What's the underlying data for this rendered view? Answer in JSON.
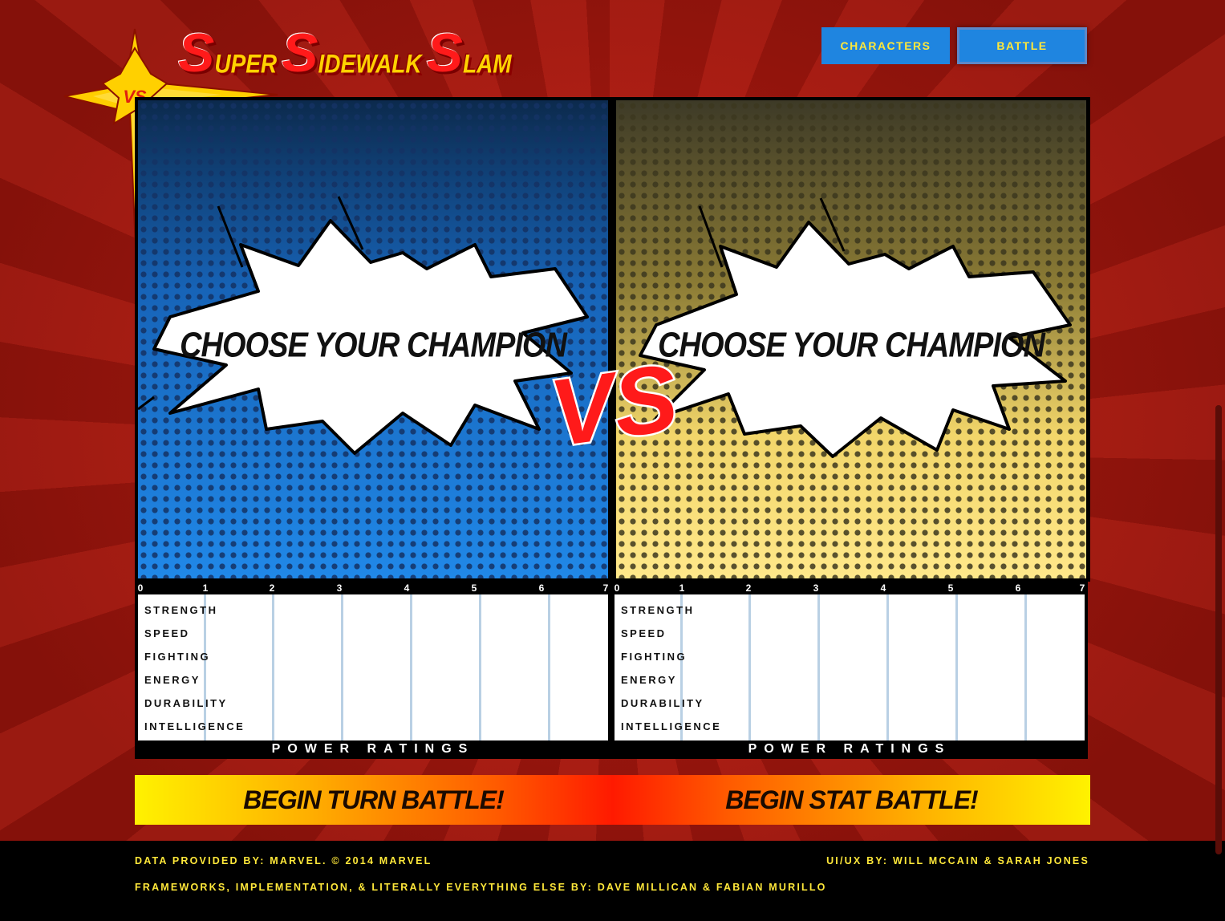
{
  "logo": {
    "words": [
      {
        "cap": "S",
        "rest": "UPER"
      },
      {
        "cap": "S",
        "rest": "IDEWALK"
      },
      {
        "cap": "S",
        "rest": "LAM"
      }
    ],
    "badge": "VS"
  },
  "nav": {
    "characters": "CHARACTERS",
    "battle": "BATTLE"
  },
  "panels": {
    "left": {
      "prompt": "CHOOSE YOUR CHAMPION"
    },
    "right": {
      "prompt": "CHOOSE YOUR CHAMPION"
    },
    "vs": "VS"
  },
  "ratings": {
    "scale": [
      "0",
      "1",
      "2",
      "3",
      "4",
      "5",
      "6",
      "7"
    ],
    "stats": [
      "STRENGTH",
      "SPEED",
      "FIGHTING",
      "ENERGY",
      "DURABILITY",
      "INTELLIGENCE"
    ],
    "title": "POWER RATINGS"
  },
  "actions": {
    "turn_battle": "BEGIN TURN BATTLE!",
    "stat_battle": "BEGIN STAT BATTLE!"
  },
  "footer": {
    "data_credit": "DATA PROVIDED BY: MARVEL. © 2014 MARVEL",
    "uiux_credit": "UI/UX BY: WILL MCCAIN & SARAH JONES",
    "dev_credit": "FRAMEWORKS, IMPLEMENTATION, & LITERALLY EVERYTHING ELSE BY: DAVE MILLICAN & FABIAN MURILLO"
  },
  "colors": {
    "accent_yellow": "#ffe83a",
    "nav_blue": "#1f85e0",
    "brand_red": "#ff1a1a"
  }
}
